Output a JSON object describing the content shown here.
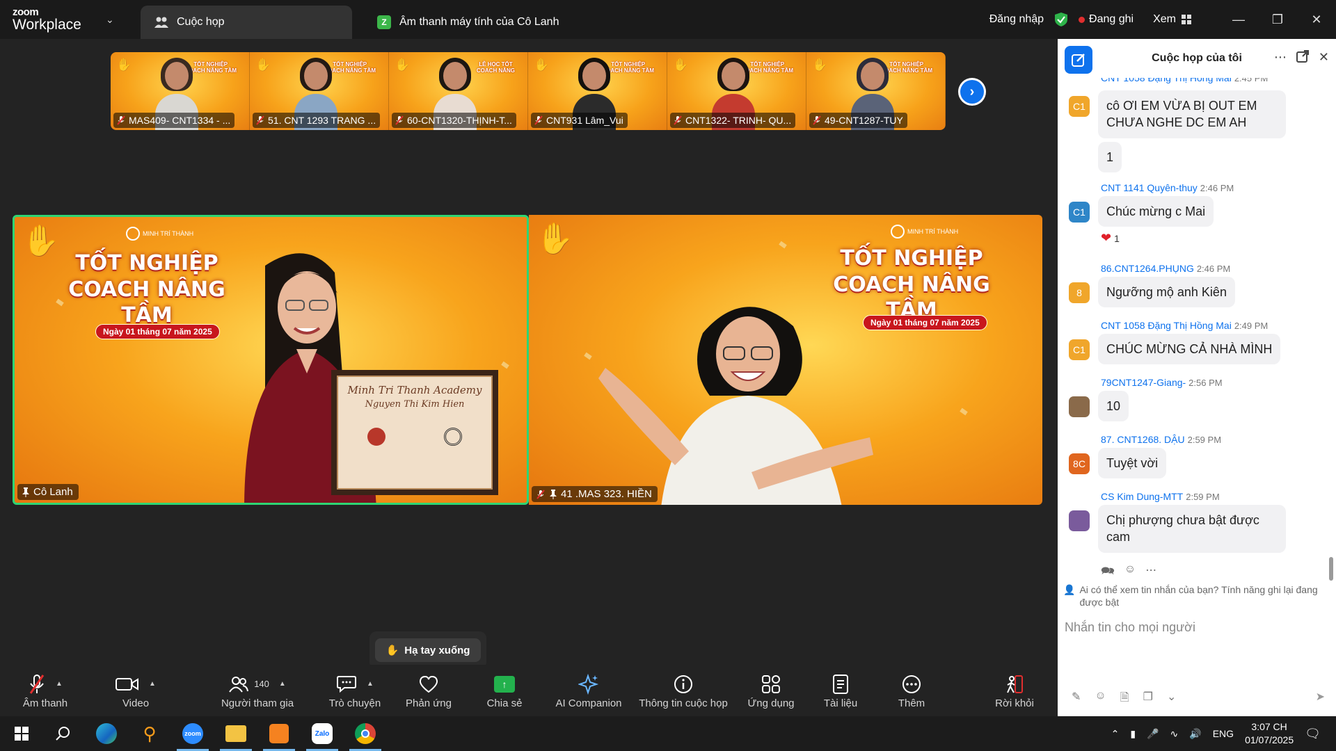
{
  "app": {
    "logo_top": "zoom",
    "logo_bottom": "Workplace",
    "tabs": [
      {
        "label": "Cuộc họp",
        "icon": "people-icon"
      },
      {
        "label": "Âm thanh máy tính của Cô Lanh",
        "icon": "zalo-badge-icon",
        "badge": "Z"
      }
    ],
    "login": "Đăng nhập",
    "recording": "Đang ghi",
    "view": "Xem"
  },
  "gallery": [
    {
      "name": "MAS409- CNT1334 - ...",
      "title": "TỐT NGHIỆP\nCOACH NÂNG TẦM",
      "hair": "#3a2a20",
      "shirt": "#d9d7d2"
    },
    {
      "name": "51. CNT 1293 TRANG ...",
      "title": "TỐT NGHIỆP\nCOACH NÂNG TẦM",
      "hair": "#241a14",
      "shirt": "#8aa6c4"
    },
    {
      "name": "60-CNT1320-THỊNH-T...",
      "title": "LỄ HỌC TỐT\nCOACH NÂNG",
      "hair": "#1d1712",
      "shirt": "#e8dcd2"
    },
    {
      "name": "CNT931 Lâm_Vui",
      "title": "TỐT NGHIỆP\nCOACH NÂNG TẦM",
      "hair": "#14110e",
      "shirt": "#2b2b2b"
    },
    {
      "name": "CNT1322- TRINH- QU...",
      "title": "TỐT NGHIỆP\nCOACH NÂNG TẦM",
      "hair": "#1c1410",
      "shirt": "#c43b2f"
    },
    {
      "name": "49-CNT1287-TUY",
      "title": "TỐT NGHIỆP\nCOACH NÂNG TẦM",
      "hair": "#2c2c3a",
      "shirt": "#5a6378"
    }
  ],
  "videos": [
    {
      "name": "Cô Lanh",
      "headline": "TỐT NGHIỆP\nCOACH NÂNG TẦM",
      "date": "Ngày 01 tháng 07 năm 2025",
      "brand": "MINH TRÍ THÀNH",
      "cert_line1": "Minh Tri Thanh Academy",
      "cert_line2": "Nguyen Thi Kim Hien"
    },
    {
      "name": "41 .MAS 323. HIỀN",
      "headline": "TỐT NGHIỆP\nCOACH NÂNG TẦM",
      "date": "Ngày 01 tháng 07 năm 2025",
      "brand": "MINH TRÍ THÀNH"
    }
  ],
  "raise_hand": "Hạ tay xuống",
  "toolbar": {
    "audio": "Âm thanh",
    "video": "Video",
    "participants": "Người tham gia",
    "participants_count": "140",
    "chat": "Trò chuyện",
    "reactions": "Phản ứng",
    "share": "Chia sẻ",
    "ai": "AI Companion",
    "info": "Thông tin cuộc họp",
    "apps": "Ứng dụng",
    "docs": "Tài liệu",
    "more": "Thêm",
    "leave": "Rời khỏi"
  },
  "chat": {
    "title": "Cuộc họp của tôi",
    "messages": [
      {
        "sender": "CNT 1058 Đặng Thị Hồng Mai",
        "time": "2:45 PM",
        "avatar": "C1",
        "avatar_color": "#f0a62b",
        "texts": [
          "cô ƠI EM VỪA BỊ OUT EM CHƯA NGHE DC EM AH",
          "1"
        ]
      },
      {
        "sender": "CNT 1141 Quyên-thuy",
        "time": "2:46 PM",
        "avatar": "C1",
        "avatar_color": "#2f86c8",
        "texts": [
          "Chúc mừng c Mai"
        ],
        "reaction": "1"
      },
      {
        "sender": "86.CNT1264.PHỤNG",
        "time": "2:46 PM",
        "avatar": "8",
        "avatar_color": "#f0a62b",
        "texts": [
          "Ngưỡng mộ anh Kiên"
        ]
      },
      {
        "sender": "CNT 1058 Đặng Thị Hồng Mai",
        "time": "2:49 PM",
        "avatar": "C1",
        "avatar_color": "#f0a62b",
        "texts": [
          "CHÚC MỪNG CẢ NHÀ MÌNH"
        ]
      },
      {
        "sender": "79CNT1247-Giang-",
        "time": "2:56 PM",
        "avatar": "",
        "avatar_color": "#8a6a4a",
        "texts": [
          "10"
        ]
      },
      {
        "sender": "87. CNT1268. DẬU",
        "time": "2:59 PM",
        "avatar": "8C",
        "avatar_color": "#e0661f",
        "texts": [
          "Tuyệt vời"
        ]
      },
      {
        "sender": "CS Kim Dung-MTT",
        "time": "2:59 PM",
        "avatar": "",
        "avatar_color": "#7a5b9c",
        "texts": [
          "Chị phượng chưa bật được cam"
        ]
      }
    ],
    "notice": "Ai có thể xem tin nhắn của bạn? Tính năng ghi lại đang được bật",
    "placeholder": "Nhắn tin cho mọi người"
  },
  "taskbar": {
    "lang": "ENG",
    "time": "3:07 CH",
    "date": "01/07/2025"
  }
}
